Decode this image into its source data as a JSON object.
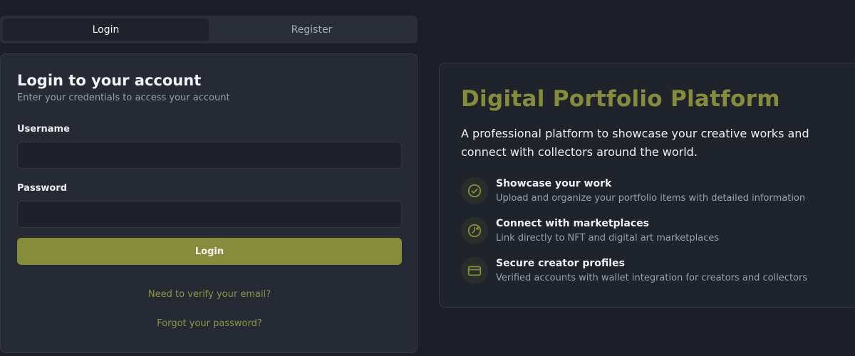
{
  "tabs": [
    {
      "label": "Login",
      "active": true
    },
    {
      "label": "Register",
      "active": false
    }
  ],
  "login": {
    "title": "Login to your account",
    "subtitle": "Enter your credentials to access your account",
    "username_label": "Username",
    "username_value": "",
    "password_label": "Password",
    "password_value": "",
    "submit_label": "Login",
    "verify_link": "Need to verify your email?",
    "forgot_link": "Forgot your password?"
  },
  "info": {
    "title": "Digital Portfolio Platform",
    "description": "A professional platform to showcase your creative works and connect with collectors around the world.",
    "features": [
      {
        "icon": "check-circle-icon",
        "title": "Showcase your work",
        "desc": "Upload and organize your portfolio items with detailed information"
      },
      {
        "icon": "clock-arrow-icon",
        "title": "Connect with marketplaces",
        "desc": "Link directly to NFT and digital art marketplaces"
      },
      {
        "icon": "credit-card-icon",
        "title": "Secure creator profiles",
        "desc": "Verified accounts with wallet integration for creators and collectors"
      }
    ]
  },
  "colors": {
    "accent": "#878c3c",
    "background": "#1c1f27",
    "card": "#262a34"
  }
}
